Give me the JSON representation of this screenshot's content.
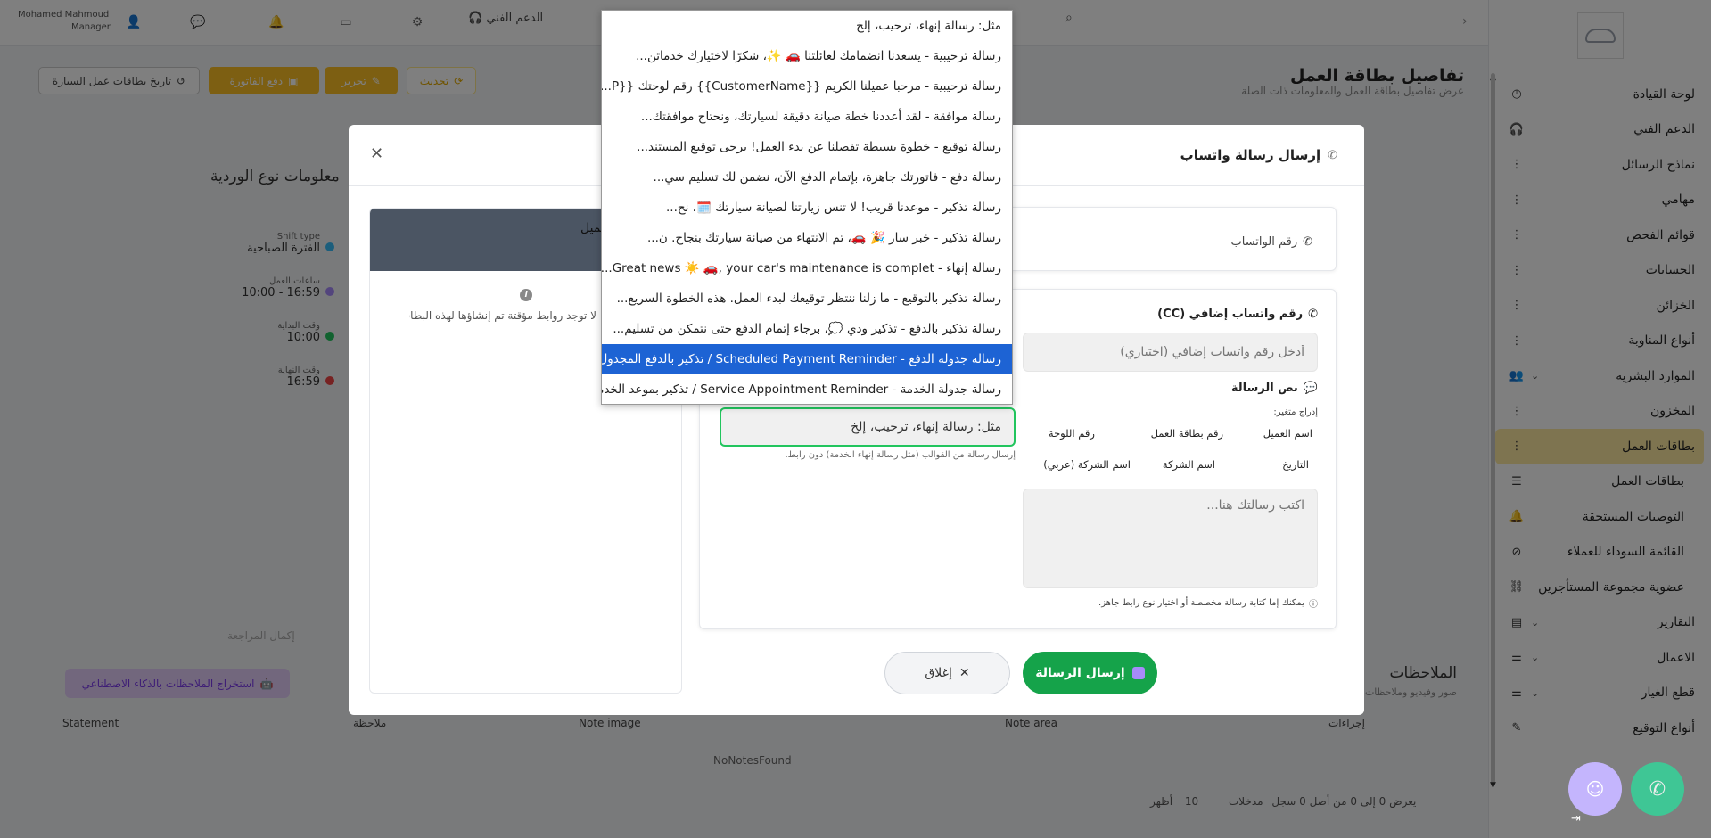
{
  "topbar": {
    "user_name": "Mohamed Mahmoud",
    "user_role": "Manager",
    "support_label": "الدعم الفني"
  },
  "sidebar": {
    "items": [
      {
        "label": "لوحة القيادة",
        "icon": "dashboard-icon",
        "trail": ""
      },
      {
        "label": "الدعم الفني",
        "icon": "headset-icon",
        "trail": ""
      },
      {
        "label": "نماذج الرسائل",
        "icon": "dots-icon",
        "trail": ""
      },
      {
        "label": "مهامي",
        "icon": "dots-icon",
        "trail": ""
      },
      {
        "label": "قوائم الفحص",
        "icon": "dots-icon",
        "trail": ""
      },
      {
        "label": "الحسابات",
        "icon": "dots-icon",
        "trail": ""
      },
      {
        "label": "الخزائن",
        "icon": "dots-icon",
        "trail": ""
      },
      {
        "label": "أنواع المناوبة",
        "icon": "dots-icon",
        "trail": ""
      },
      {
        "label": "الموارد البشرية",
        "icon": "users-icon",
        "trail": "⌄"
      },
      {
        "label": "المخزون",
        "icon": "dots-icon",
        "trail": ""
      },
      {
        "label": "بطاقات العمل",
        "icon": "dots-icon",
        "trail": "",
        "active": true
      },
      {
        "label": "بطاقات العمل",
        "icon": "list-icon",
        "trail": "",
        "sub": true
      },
      {
        "label": "التوصيات المستحقة",
        "icon": "bell-icon",
        "trail": "",
        "sub": true
      },
      {
        "label": "القائمة السوداء للعملاء",
        "icon": "ban-icon",
        "trail": "",
        "sub": true
      },
      {
        "label": "عضوية مجموعة المستأجرين",
        "icon": "network-icon",
        "trail": "",
        "sub": true
      },
      {
        "label": "التقارير",
        "icon": "chart-icon",
        "trail": "⌄"
      },
      {
        "label": "الاعمال",
        "icon": "sliders-icon",
        "trail": "⌄"
      },
      {
        "label": "قطع الغيار",
        "icon": "sliders-icon",
        "trail": "⌄"
      },
      {
        "label": "أنواع التوقيع",
        "icon": "pen-icon",
        "trail": ""
      }
    ]
  },
  "page": {
    "title": "تفاصيل بطاقة العمل",
    "subtitle": "عرض تفاصيل بطاقة العمل والمعلومات ذات الصلة",
    "btn_history": "تاريخ بطاقات عمل السيارة",
    "btn_pay": "دفع الفاتورة",
    "btn_edit": "تحرير",
    "btn_update": "تحديث",
    "shift_title": "معلومات نوع الوردية",
    "shift_type_k": "Shift type",
    "shift_type_v": "الفترة الصباحية",
    "work_hours_k": "ساعات العمل",
    "work_hours_v": "16:59 - 10:00",
    "start_k": "وقت البداية",
    "start_v": "10:00",
    "end_k": "وقت النهاية",
    "end_v": "16:59",
    "notes_title": "الملاحظات",
    "notes_sub": "صور وفيديو وملاحظات",
    "notes_header": [
      "إجراءات",
      "Note area",
      "Note image",
      "ملاحظة",
      "Statement"
    ],
    "no_notes": "NoNotesFound",
    "ai_btn": "استخراج الملاحظات بالذكاء الاصطناعي",
    "show_label": "أظهر",
    "per_page": "10",
    "entries_label": "مدخلات",
    "pager_info": "يعرض 0 إلى 0 من أصل 0 سجل",
    "complete_review": "إكمال المراجعة"
  },
  "modal": {
    "title": "إرسال رسالة واتساب",
    "phone_label": "رقم الواتساب",
    "cc_label": "رقم واتساب إضافي (CC)",
    "cc_placeholder": "أدخل رقم واتساب إضافي (اختياري)",
    "msg_label": "نص الرسالة",
    "var_label": "إدراج متغير:",
    "variables": [
      "اسم العميل",
      "رقم بطاقة العمل",
      "رقم اللوحة",
      "التاريخ",
      "اسم الشركة",
      "اسم الشركة (عربي)"
    ],
    "msg_placeholder": "اكتب رسالتك هنا...",
    "msg_hint": "يمكنك إما كتابة رسالة مخصصة أو اختيار نوع رابط جاهز.",
    "template_value": "مثل: رسالة إنهاء، ترحيب، إلخ",
    "template_hint": "إرسال رسالة من القوالب (مثل رسالة إنهاء الخدمة) دون رابط.",
    "preview_head": "معاينة العميل",
    "preview_info": "لا توجد روابط مؤقتة تم إنشاؤها لهذه البطاقة بعد.",
    "send_btn": "إرسال الرسالة",
    "close_btn": "إغلاق"
  },
  "dropdown": {
    "options": [
      "مثل: رسالة إنهاء، ترحيب، إلخ",
      "رسالة ترحيبية - يسعدنا انضمامك لعائلتنا 🚗 ✨، شكرًا لاختيارك خدماتن...",
      "رسالة ترحيبية - مرحبا عميلنا الكريم {{CustomerName}} رقم لوحتك {{P...",
      "رسالة موافقة - لقد أعددنا خطة صيانة دقيقة لسيارتك، ونحتاج موافقتك...",
      "رسالة توقيع - خطوة بسيطة تفصلنا عن بدء العمل! يرجى توقيع المستند...",
      "رسالة دفع - فاتورتك جاهزة، بإتمام الدفع الآن، نضمن لك تسليم سي...",
      "رسالة تذكير - موعدنا قريب! لا تنس زيارتنا لصيانة سيارتك 🗓️، نح...",
      "رسالة تذكير - خبر سار 🎉 🚗، تم الانتهاء من صيانة سيارتك بنجاح. ن...",
      "رسالة إنهاء - Great news ☀️ 🚗, your car's maintenance is complet...",
      "رسالة تذكير بالتوقيع - ما زلنا ننتظر توقيعك لبدء العمل. هذه الخطوة السريع...",
      "رسالة تذكير بالدفع - تذكير ودي 💭، برجاء إتمام الدفع حتى نتمكن من تسليم...",
      "رسالة جدولة الدفع - Scheduled Payment Reminder / تذكير بالدفع المجدول ...",
      "رسالة جدولة الخدمة - Service Appointment Reminder / تذكير بموعد الخدمة ..."
    ],
    "selected_index": 11
  }
}
